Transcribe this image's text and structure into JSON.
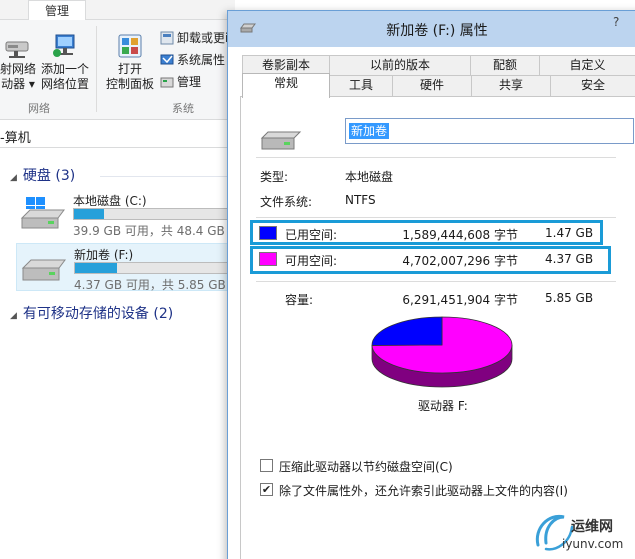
{
  "explorer": {
    "ribbon_tab_manage": "管理",
    "map_drive_label_1": "射网络",
    "map_drive_label_2": "动器 ▾",
    "add_location_label_1": "添加一个",
    "add_location_label_2": "网络位置",
    "network_group": "网络",
    "control_panel_label_1": "打开",
    "control_panel_label_2": "控制面板",
    "uninstall_label": "卸载或更i",
    "system_properties_label": "系统属性",
    "manage_label": "管理",
    "system_group": "系统",
    "address_text": "-算机",
    "hard_disks_header": "硬盘 (3)",
    "removable_header": "有可移动存储的设备 (2)",
    "drives": [
      {
        "name": "本地磁盘 (C:)",
        "status": "39.9 GB 可用，共 48.4 GB",
        "used_fraction": 0.18
      },
      {
        "name": "新加卷 (F:)",
        "status": "4.37 GB 可用，共 5.85 GB",
        "used_fraction": 0.25
      }
    ]
  },
  "dialog": {
    "title": "新加卷 (F:) 属性",
    "help": "?",
    "tabs_row1": [
      "卷影副本",
      "以前的版本",
      "配额",
      "自定义"
    ],
    "tabs_row2": [
      "常规",
      "工具",
      "硬件",
      "共享",
      "安全"
    ],
    "active_tab": "常规",
    "volume_name": "新加卷",
    "type_label": "类型:",
    "type_value": "本地磁盘",
    "fs_label": "文件系统:",
    "fs_value": "NTFS",
    "used_label": "已用空间:",
    "used_bytes": "1,589,444,608 字节",
    "used_size": "1.47 GB",
    "free_label": "可用空间:",
    "free_bytes": "4,702,007,296 字节",
    "free_size": "4.37 GB",
    "capacity_label": "容量:",
    "capacity_bytes": "6,291,451,904 字节",
    "capacity_size": "5.85 GB",
    "drive_label": "驱动器 F:",
    "compress_label": "压缩此驱动器以节约磁盘空间(C)",
    "compress_checked": false,
    "index_label": "除了文件属性外，还允许索引此驱动器上文件的内容(I)",
    "index_checked": true,
    "used_color": "#0000ff",
    "free_color": "#ff00ff",
    "used_fraction": 0.2526
  },
  "watermark": {
    "cn": "运维网",
    "en": "iyunv.com"
  }
}
